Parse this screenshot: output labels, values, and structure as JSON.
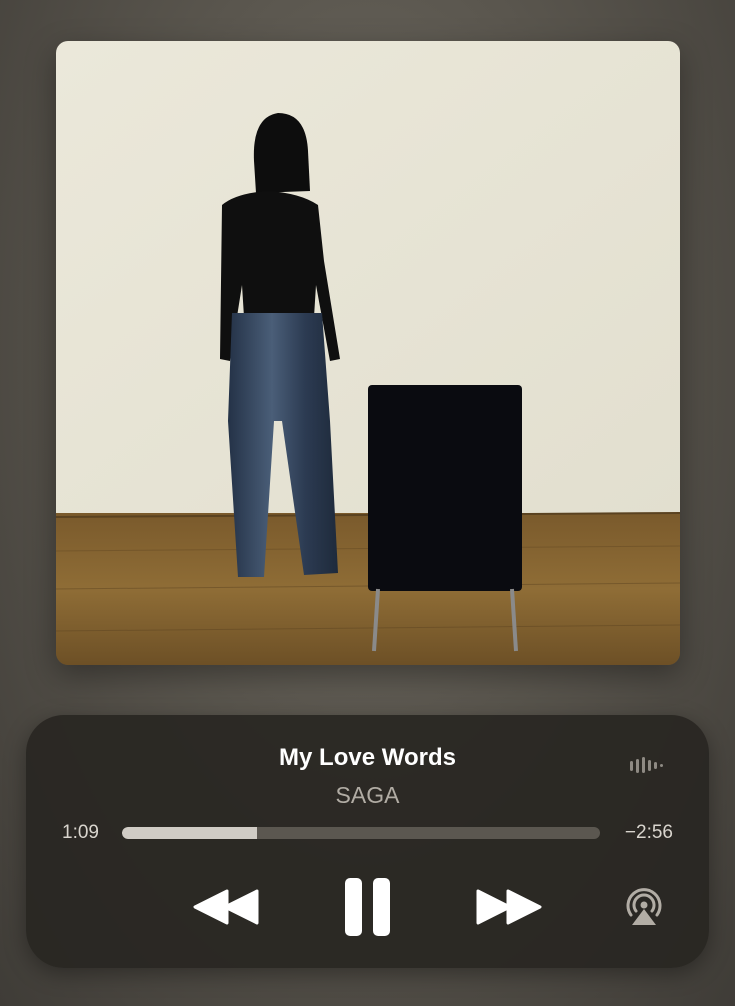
{
  "album": {
    "artwork_icon": "album-artwork"
  },
  "track": {
    "title": "My Love Words",
    "artist": "SAGA"
  },
  "playback": {
    "elapsed": "1:09",
    "remaining": "−2:56",
    "progress_fraction": 0.283
  },
  "controls": {
    "rewind_icon": "rewind-icon",
    "pause_icon": "pause-icon",
    "forward_icon": "fast-forward-icon",
    "airplay_icon": "airplay-icon",
    "waveform_icon": "audio-waveform-icon"
  },
  "colors": {
    "title": "#ffffff",
    "artist": "#b1aca4",
    "progress_fill": "#d0ccc5",
    "progress_track": "#5b5750",
    "panel": "#282622"
  }
}
